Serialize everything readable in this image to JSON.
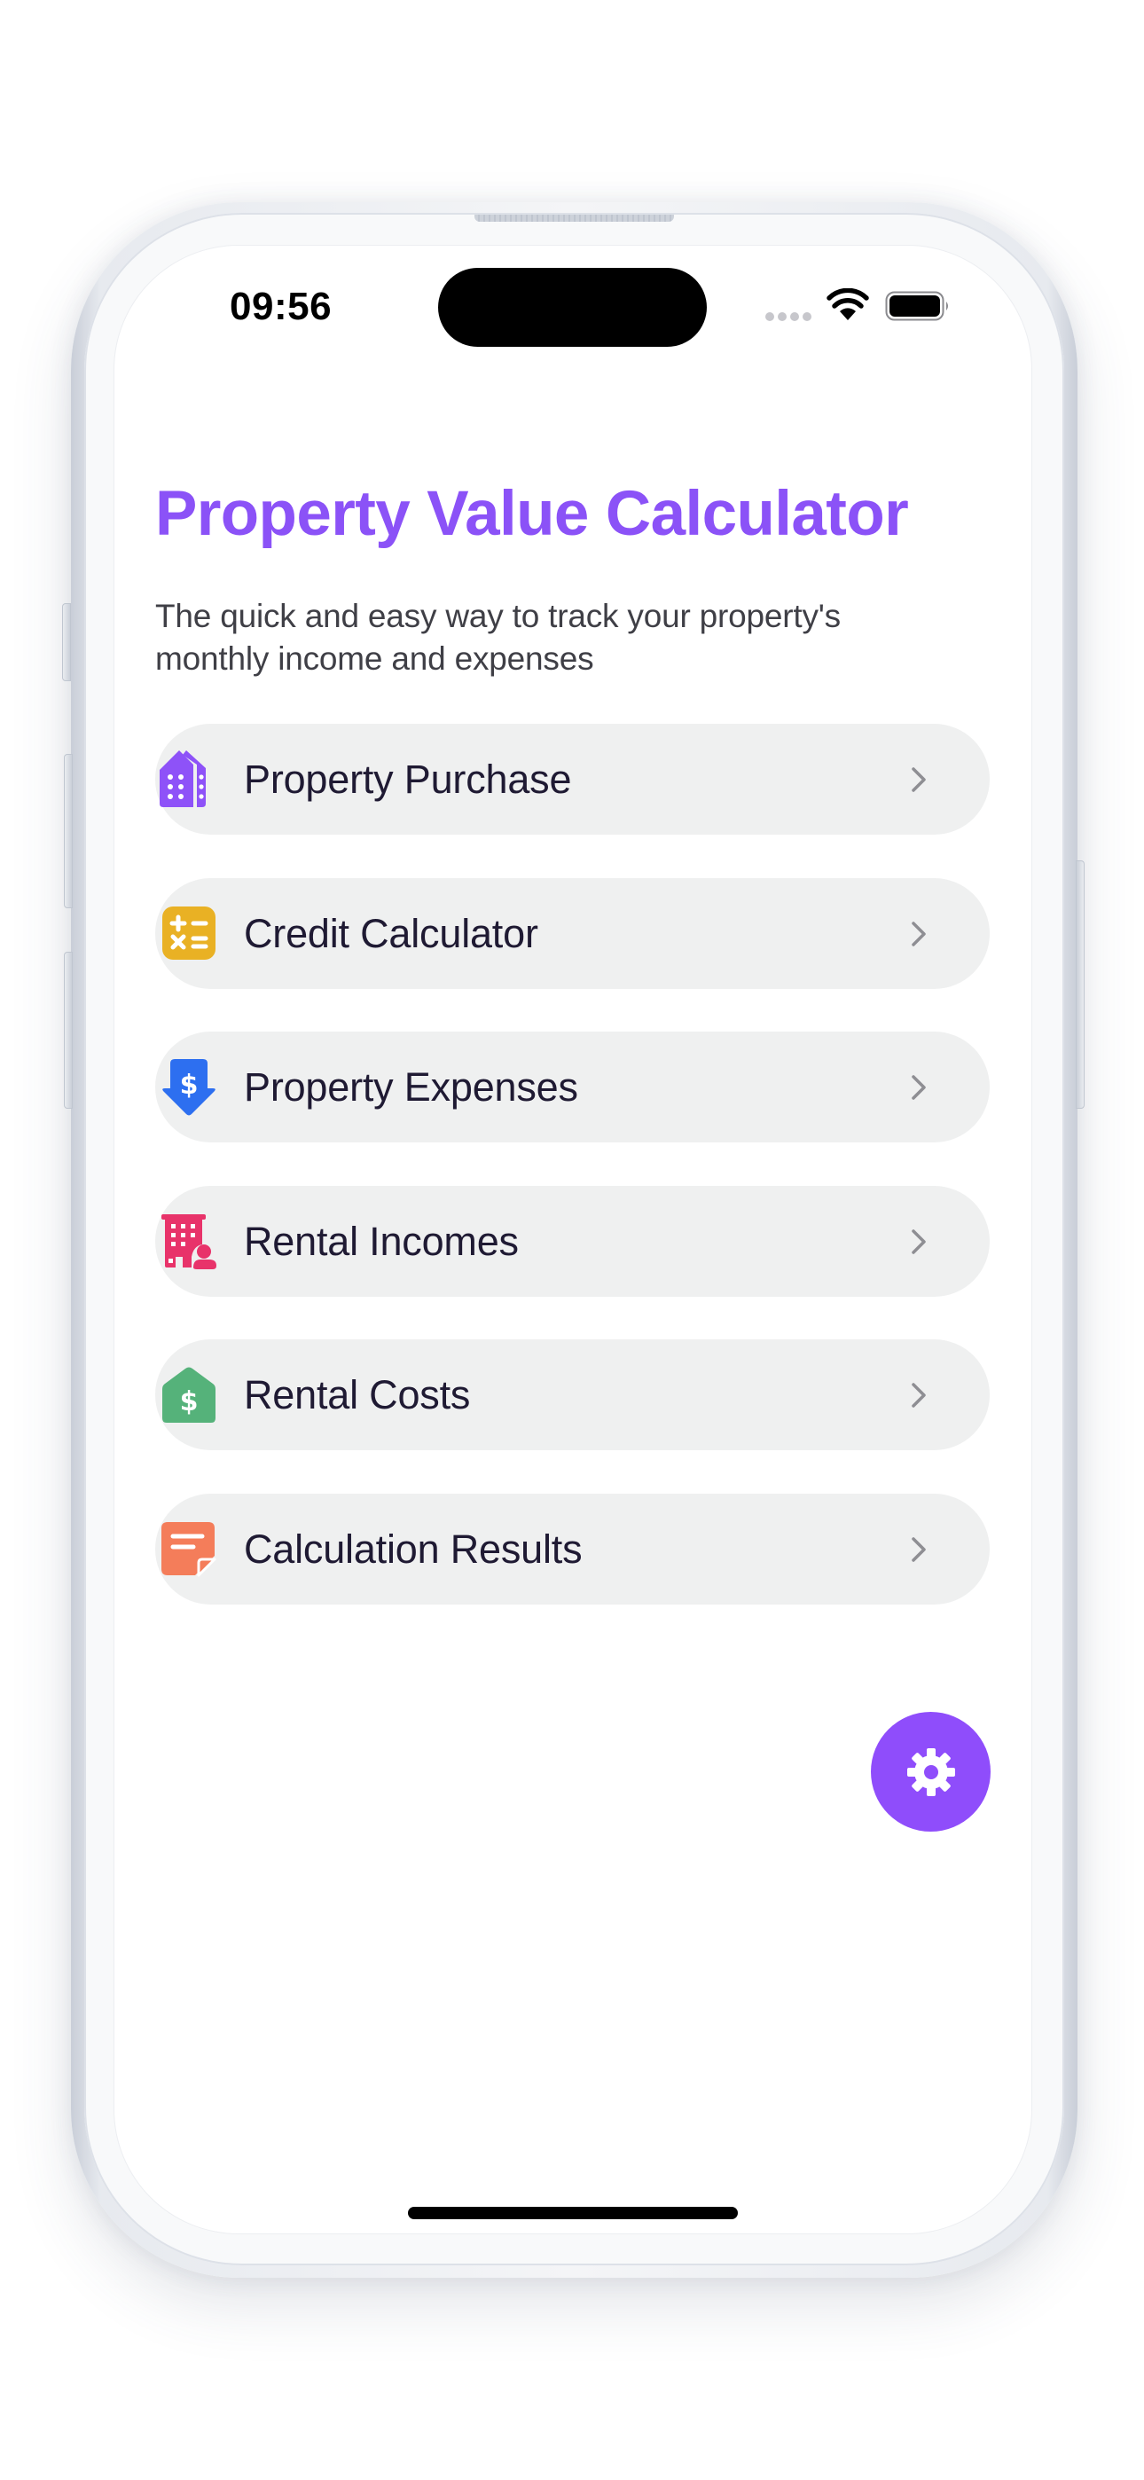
{
  "status_bar": {
    "time": "09:56",
    "signal_icon": "signal-dots-icon",
    "wifi_icon": "wifi-icon",
    "battery_icon": "battery-icon"
  },
  "header": {
    "title": "Property Value Calculator",
    "subtitle": "The quick and easy way to track your property's monthly income and expenses"
  },
  "menu": {
    "items": [
      {
        "label": "Property Purchase",
        "icon": "buildings-icon",
        "color": "#8e52f8"
      },
      {
        "label": "Credit Calculator",
        "icon": "calculator-icon",
        "color": "#e9b124"
      },
      {
        "label": "Property Expenses",
        "icon": "dollar-down-arrow-icon",
        "color": "#2d6ff0"
      },
      {
        "label": "Rental Incomes",
        "icon": "building-tenant-icon",
        "color": "#e8336a"
      },
      {
        "label": "Rental Costs",
        "icon": "house-dollar-icon",
        "color": "#55b27a"
      },
      {
        "label": "Calculation Results",
        "icon": "note-icon",
        "color": "#f47d5a"
      }
    ]
  },
  "fab": {
    "icon": "gear-icon",
    "color": "#8f4dfb",
    "label": "Settings"
  },
  "colors": {
    "accent": "#8b52f7",
    "row_background": "#eff0f0",
    "row_text": "#1f1a33",
    "chevron": "#8e8e93"
  }
}
